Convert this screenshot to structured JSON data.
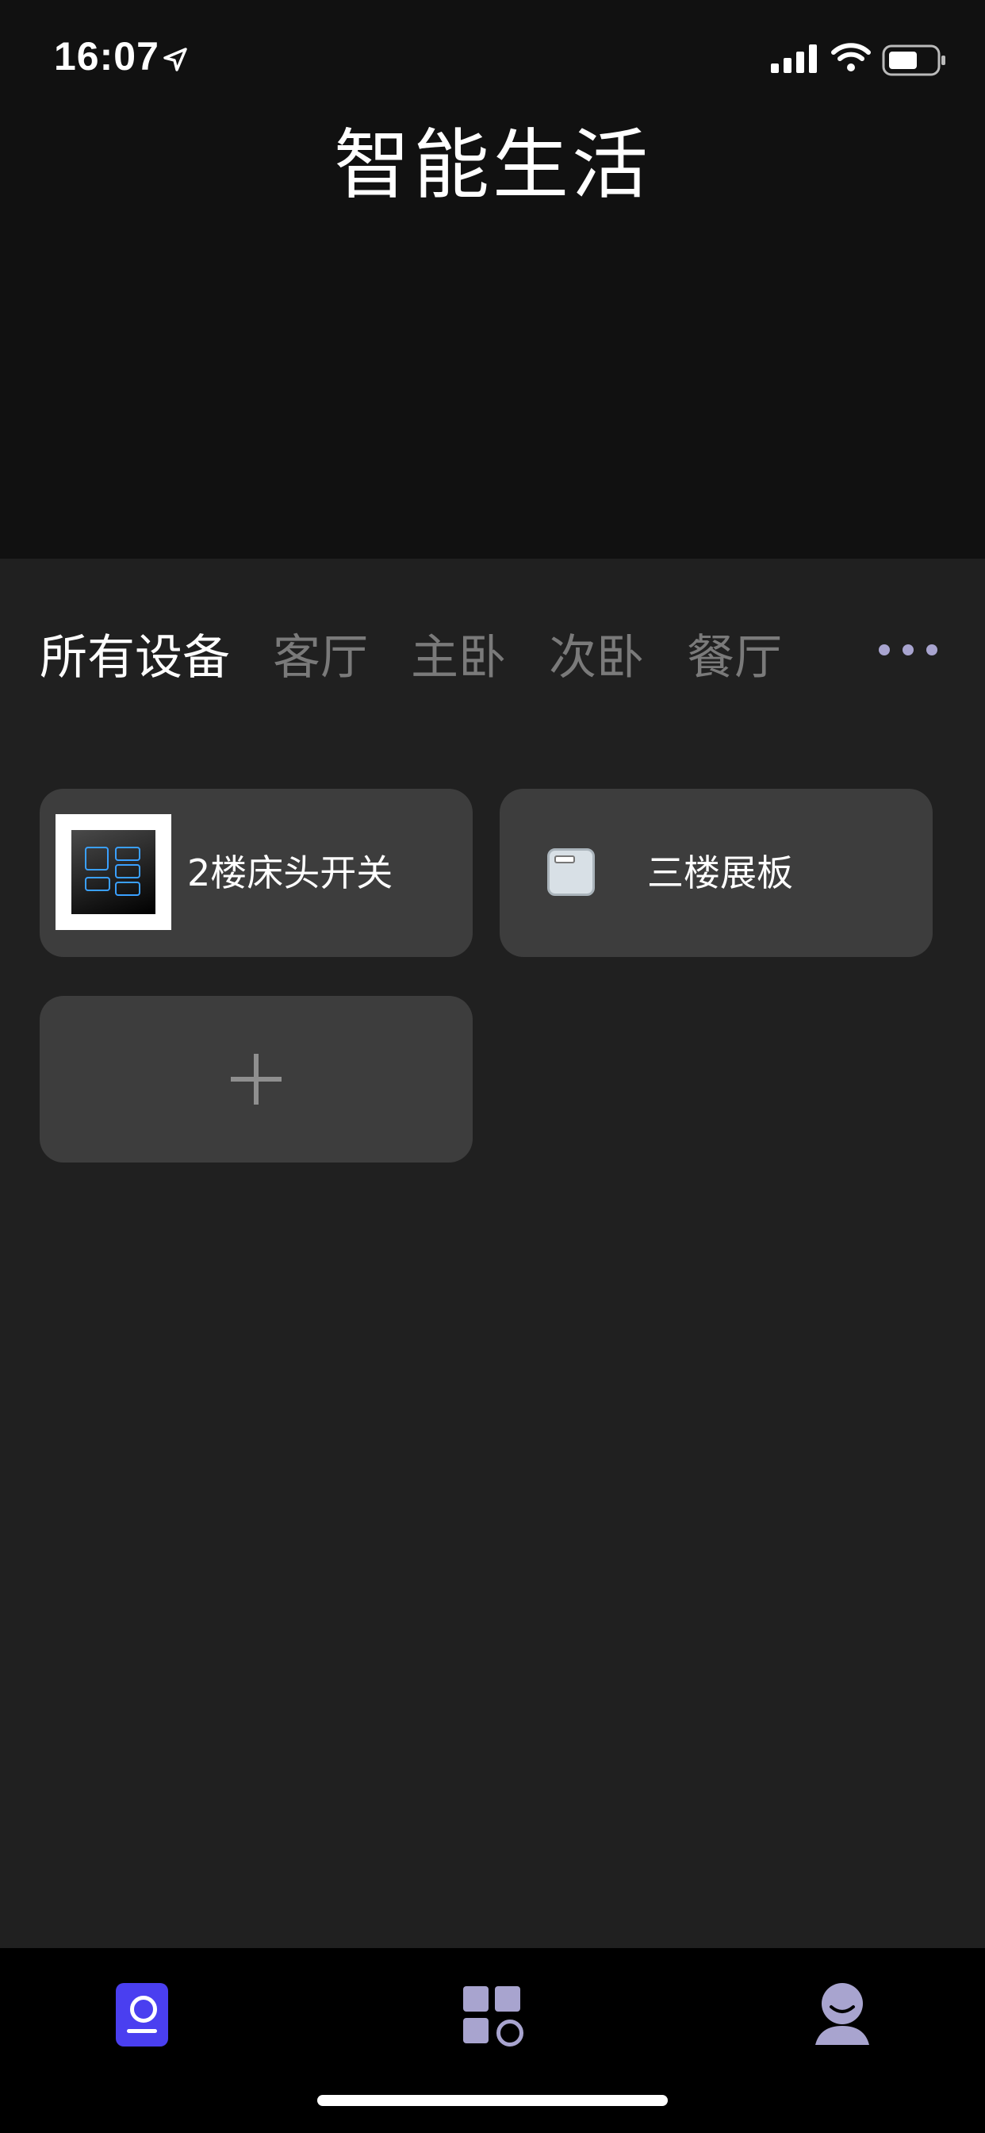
{
  "status_bar": {
    "time": "16:07"
  },
  "header": {
    "title": "智能生活"
  },
  "room_tabs": [
    {
      "label": "所有设备",
      "active": true
    },
    {
      "label": "客厅",
      "active": false
    },
    {
      "label": "主卧",
      "active": false
    },
    {
      "label": "次卧",
      "active": false
    },
    {
      "label": "餐厅",
      "active": false
    }
  ],
  "devices": [
    {
      "name": "2楼床头开关",
      "icon": "wall-switch-thumbnail"
    },
    {
      "name": "三楼展板",
      "icon": "panel-icon"
    }
  ],
  "add_device": {
    "icon": "plus-icon"
  },
  "tab_bar": {
    "items": [
      {
        "icon": "home-icon",
        "active": true
      },
      {
        "icon": "grid-apps-icon",
        "active": false
      },
      {
        "icon": "profile-icon",
        "active": false
      }
    ]
  },
  "colors": {
    "accent": "#4a3ff0",
    "icon_inactive": "#a8a4cf",
    "card_bg": "#3d3d3d",
    "header_bg": "#111111",
    "page_bg": "#202020"
  }
}
